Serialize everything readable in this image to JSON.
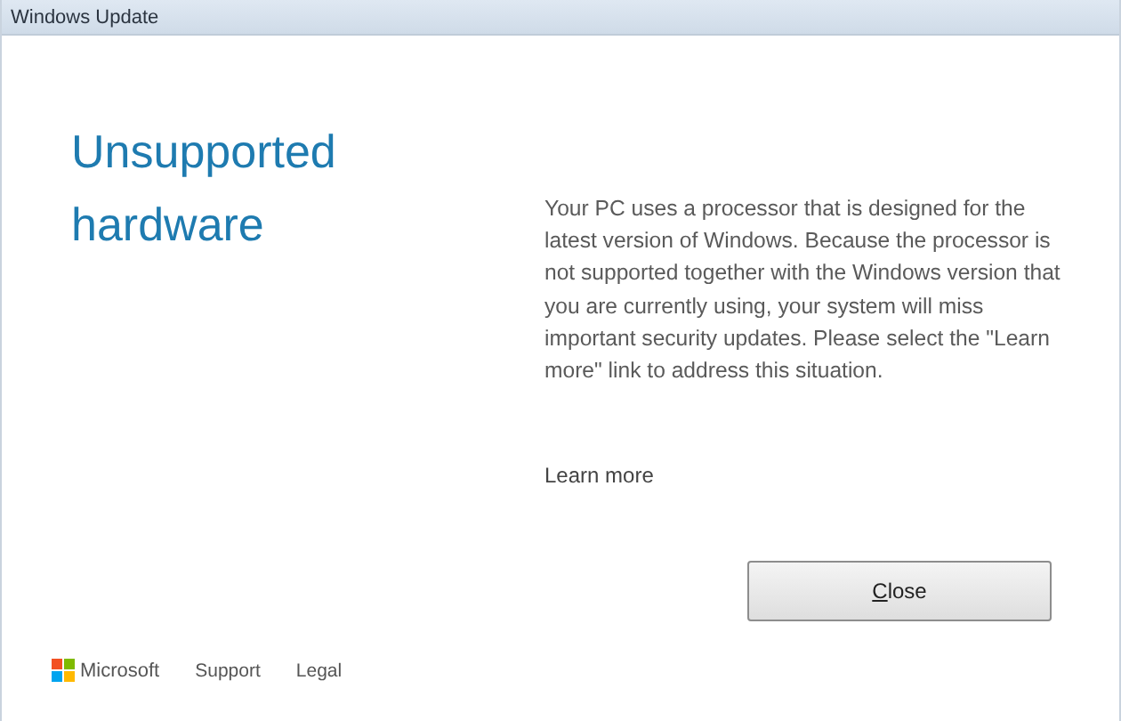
{
  "window": {
    "title": "Windows Update"
  },
  "heading": "Unsupported hardware",
  "message": "Your PC uses a processor that is designed for the latest version of Windows. Because the processor is not supported together with the Windows version that you are currently using, your system will miss important security updates. Please select the \"Learn more\" link to address this situation.",
  "learn_more": "Learn more",
  "close_button": "Close",
  "footer": {
    "brand": "Microsoft",
    "links": [
      "Support",
      "Legal"
    ]
  }
}
